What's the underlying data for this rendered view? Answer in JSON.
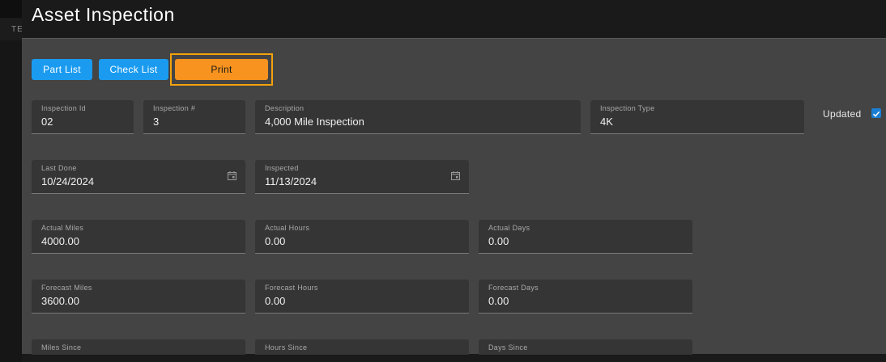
{
  "background": {
    "tab_label": "TE"
  },
  "dialog": {
    "title": "Asset Inspection"
  },
  "toolbar": {
    "part_list": "Part List",
    "check_list": "Check List",
    "print": "Print"
  },
  "fields": {
    "inspection_id": {
      "label": "Inspection Id",
      "value": "02"
    },
    "inspection_no": {
      "label": "Inspection #",
      "value": "3"
    },
    "description": {
      "label": "Description",
      "value": "4,000 Mile Inspection"
    },
    "inspection_type": {
      "label": "Inspection Type",
      "value": "4K"
    },
    "last_done": {
      "label": "Last Done",
      "value": "10/24/2024"
    },
    "inspected": {
      "label": "Inspected",
      "value": "11/13/2024"
    },
    "actual_miles": {
      "label": "Actual Miles",
      "value": "4000.00"
    },
    "actual_hours": {
      "label": "Actual Hours",
      "value": "0.00"
    },
    "actual_days": {
      "label": "Actual Days",
      "value": "0.00"
    },
    "forecast_miles": {
      "label": "Forecast Miles",
      "value": "3600.00"
    },
    "forecast_hours": {
      "label": "Forecast Hours",
      "value": "0.00"
    },
    "forecast_days": {
      "label": "Forecast Days",
      "value": "0.00"
    },
    "miles_since": {
      "label": "Miles Since",
      "value": ""
    },
    "hours_since": {
      "label": "Hours Since",
      "value": ""
    },
    "days_since": {
      "label": "Days Since",
      "value": ""
    }
  },
  "updated": {
    "label": "Updated",
    "checked": true
  },
  "colors": {
    "accent_blue": "#1a9bf0",
    "print_orange": "#f7931e",
    "checkbox": "#1a7fd4"
  },
  "icons": {
    "calendar": "calendar-icon",
    "check": "checkmark-icon"
  }
}
